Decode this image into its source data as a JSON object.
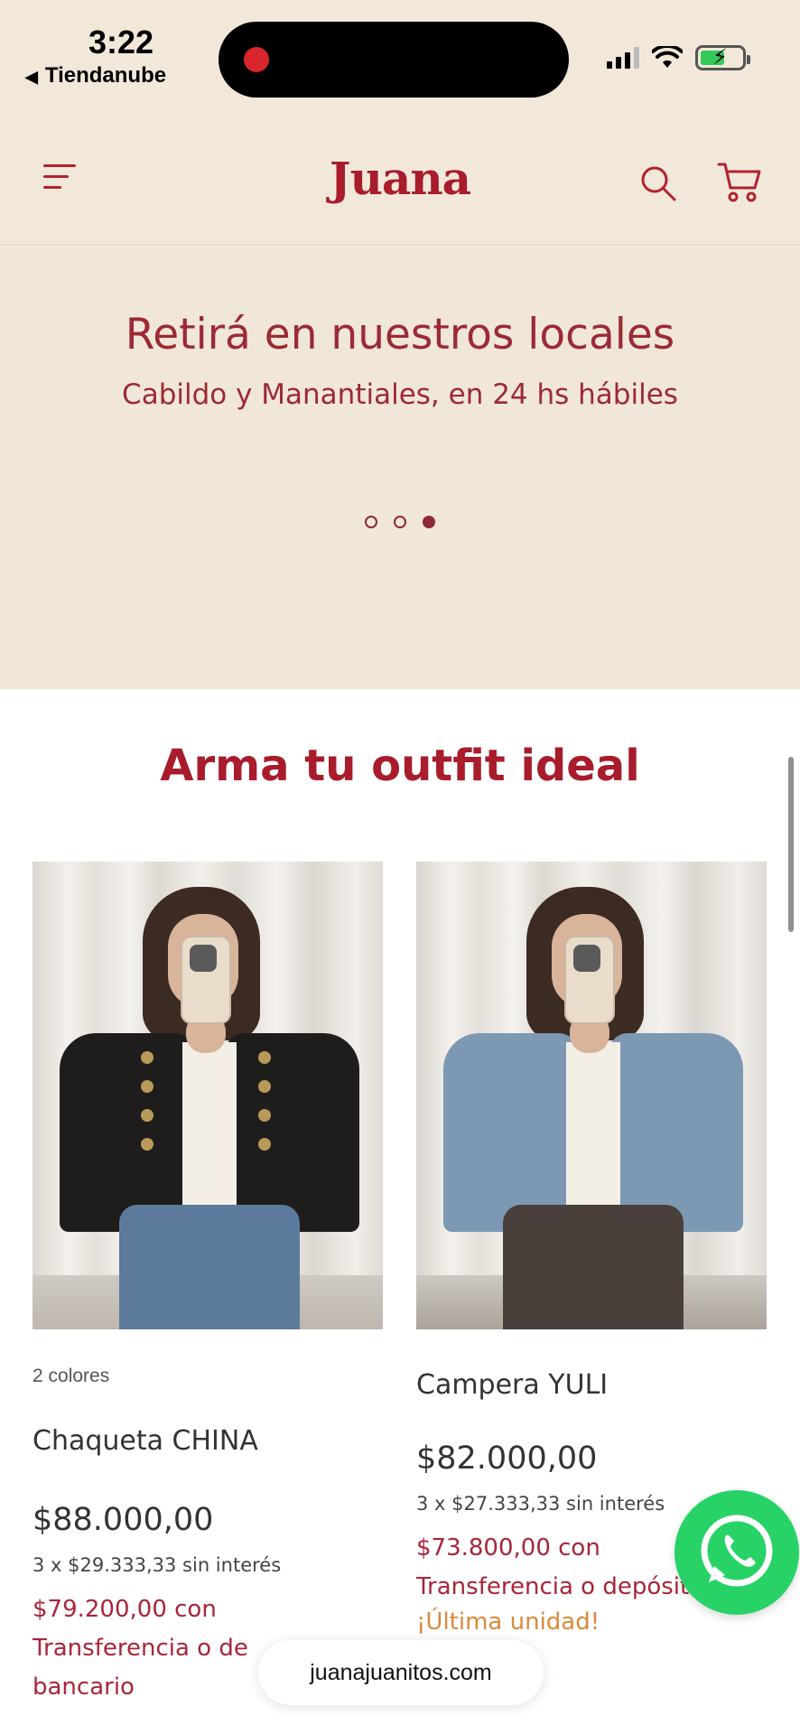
{
  "status_bar": {
    "time": "3:22",
    "back_app": "Tiendanube"
  },
  "header": {
    "logo": "Juana",
    "menu_icon": "menu-icon",
    "search_icon": "search-icon",
    "cart_icon": "cart-icon",
    "brand_color": "#a81c2c"
  },
  "banner": {
    "title": "Retirá en nuestros locales",
    "subtitle": "Cabildo y Manantiales, en 24 hs hábiles",
    "slides": 3,
    "active_slide": 3
  },
  "section": {
    "title": "Arma tu outfit ideal"
  },
  "products": [
    {
      "colors_note": "2 colores",
      "name": "Chaqueta CHINA",
      "price": "$88.000,00",
      "installments": "3 x $29.333,33 sin interés",
      "transfer_price": "$79.200,00 con",
      "transfer_text_1": "Transferencia o de",
      "transfer_text_2": "bancario"
    },
    {
      "name": "Campera YULI",
      "price": "$82.000,00",
      "installments": "3 x $27.333,33 sin interés",
      "transfer_price": "$73.800,00 con",
      "transfer_text_1": "Transferencia o depósito",
      "unit_note": "¡Última unidad!"
    }
  ],
  "url": "juanajuanitos.com",
  "colors": {
    "background_beige": "#f2e8d9",
    "accent_red": "#a81c2c",
    "whatsapp_green": "#27d366",
    "unit_orange": "#d98a3a"
  }
}
